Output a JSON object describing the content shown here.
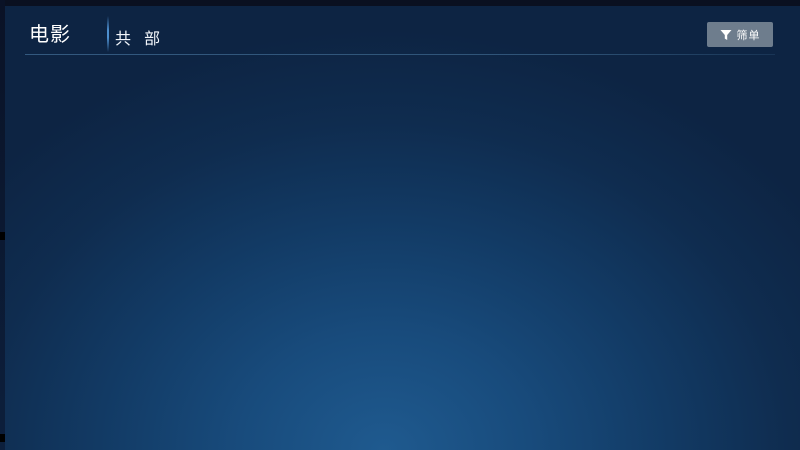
{
  "header": {
    "title": "电影",
    "category": "共 部",
    "filter_button": {
      "label": "筛单",
      "icon": "filter-icon"
    }
  },
  "colors": {
    "background_center": "#1f5a8f",
    "background_edge": "#0d2443",
    "accent_divider": "#4d8fcf",
    "filter_button_bg": "#6e7d8d"
  }
}
